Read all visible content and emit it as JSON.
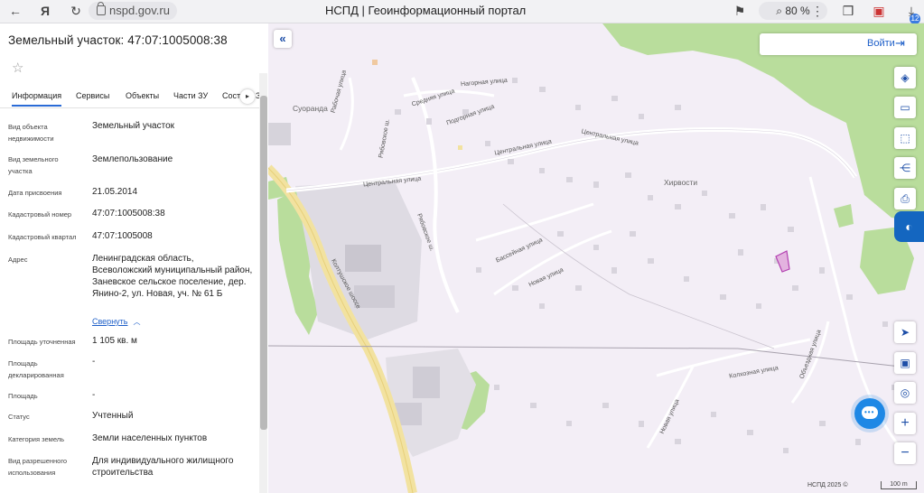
{
  "browser": {
    "url": "nspd.gov.ru",
    "title": "НСПД | Геоинформационный портал",
    "zoom": "80 %",
    "downloads_badge": "12",
    "icons": [
      "back-arrow-icon",
      "yandex-icon",
      "refresh-icon",
      "lock-icon",
      "bookmark-icon",
      "search-zoom-icon",
      "more-icon",
      "collections-icon",
      "extension-icon",
      "download-icon"
    ]
  },
  "panel": {
    "title": "Земельный участок: 47:07:1005008:38",
    "tabs": [
      "Информация",
      "Сервисы",
      "Объекты",
      "Части ЗУ",
      "Сост"
    ],
    "tab_overflow": "З",
    "fields": [
      {
        "label": "Вид объекта недвижимости",
        "value": "Земельный участок"
      },
      {
        "label": "Вид земельного участка",
        "value": "Землепользование"
      },
      {
        "label": "Дата присвоения",
        "value": "21.05.2014"
      },
      {
        "label": "Кадастровый номер",
        "value": "47:07:1005008:38"
      },
      {
        "label": "Кадастровый квартал",
        "value": "47:07:1005008"
      },
      {
        "label": "Адрес",
        "value": "Ленинградская область, Всеволожский муниципальный район, Заневское сельское поселение, дер. Янино-2, ул. Новая, уч. № 61 Б"
      },
      {
        "label": "Площадь уточненная",
        "value": "1 105 кв. м"
      },
      {
        "label": "Площадь декларированная",
        "value": "-"
      },
      {
        "label": "Площадь",
        "value": "-"
      },
      {
        "label": "Статус",
        "value": "Учтенный"
      },
      {
        "label": "Категория земель",
        "value": "Земли населенных пунктов"
      },
      {
        "label": "Вид разрешенного использования",
        "value": "Для индивидуального жилищного строительства"
      }
    ],
    "collapse_link": "Свернуть"
  },
  "map": {
    "login_label": "Войти",
    "tools": [
      "layers-icon",
      "ruler-icon",
      "select-area-icon",
      "share-icon",
      "print-icon",
      "egrn-icon",
      "locate-icon",
      "minimap-icon",
      "geolocation-icon",
      "zoom-in-icon",
      "zoom-out-icon"
    ],
    "labels": {
      "suoranda": "Суоранда",
      "khirvosti": "Хирвости",
      "central_st_1": "Центральная улица",
      "central_st_2": "Центральная улица",
      "central_st_3": "Центральная улица",
      "nagornaya": "Нагорная улица",
      "srednyaya": "Средняя улица",
      "podgornaya": "Подгорная улица",
      "rabochaya": "Рабочая улица",
      "ryabovskoe": "Рябовское ш.",
      "ryabovskoe2": "Рябовское ш.",
      "basseynaya": "Бассейная улица",
      "novaya": "Новая улица",
      "novaya2": "Новая улица",
      "kolhoznaya": "Колхозная улица",
      "obyezdnaya": "Объездная улица",
      "koltushskoe": "Колтушское шоссе"
    },
    "copyright": "НСПД 2025 ©",
    "scale": "100 m"
  },
  "colors": {
    "accent": "#1e5fc8",
    "forest": "#b9dd9c",
    "map_bg": "#f3eef6",
    "parcel": "#d58ad0"
  }
}
